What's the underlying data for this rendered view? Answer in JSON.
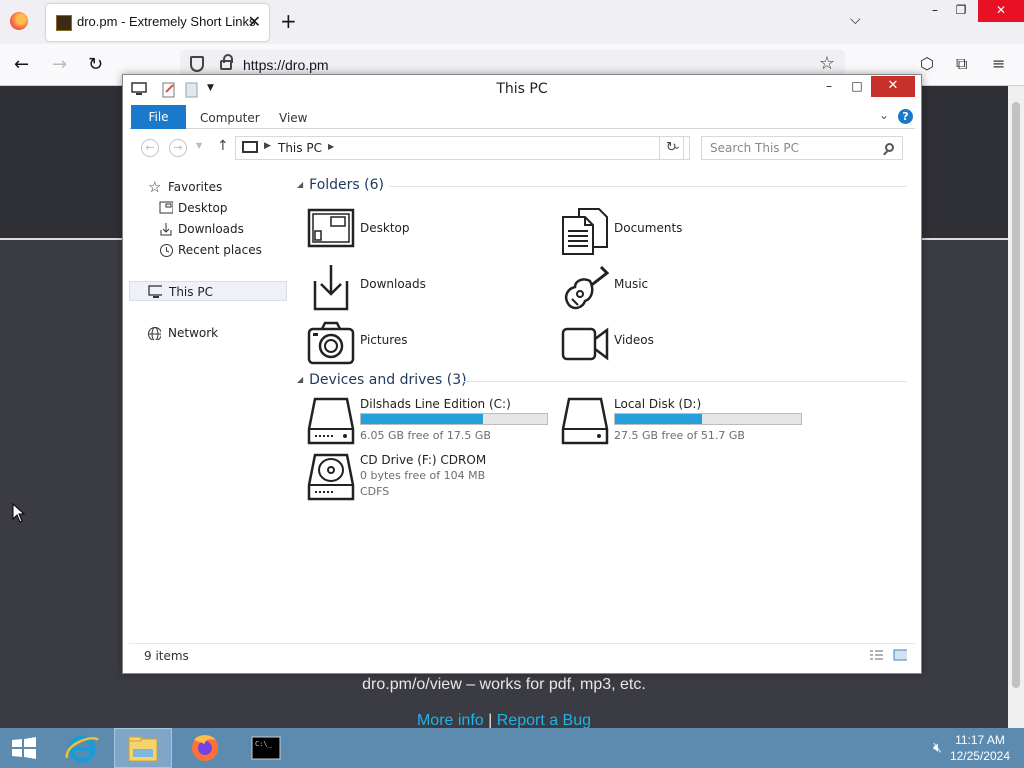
{
  "browser": {
    "tab_title": "dro.pm - Extremely Short Links",
    "url": "https://dro.pm",
    "new_tab_symbol": "+",
    "tab_close_symbol": "✕"
  },
  "page": {
    "line1": "dro.pm/o/view – works for pdf, mp3, etc.",
    "more_info": "More info",
    "separator": "|",
    "report_bug": "Report a Bug"
  },
  "explorer": {
    "title": "This PC",
    "ribbon": {
      "file": "File",
      "computer": "Computer",
      "view": "View",
      "help": "?"
    },
    "address": {
      "location": "This PC"
    },
    "search": {
      "placeholder": "Search This PC"
    },
    "nav": {
      "favorites": "Favorites",
      "desktop": "Desktop",
      "downloads": "Downloads",
      "recent": "Recent places",
      "this_pc": "This PC",
      "network": "Network"
    },
    "folders_header": "Folders (6)",
    "folders": [
      {
        "name": "Desktop",
        "icon": "desktop-icon"
      },
      {
        "name": "Documents",
        "icon": "documents-icon"
      },
      {
        "name": "Downloads",
        "icon": "downloads-icon"
      },
      {
        "name": "Music",
        "icon": "music-icon"
      },
      {
        "name": "Pictures",
        "icon": "pictures-icon"
      },
      {
        "name": "Videos",
        "icon": "videos-icon"
      }
    ],
    "devices_header": "Devices and drives (3)",
    "drives": [
      {
        "name": "Dilshads Line Edition (C:)",
        "free": "6.05 GB free of 17.5 GB",
        "used_fraction": 0.654
      },
      {
        "name": "Local Disk (D:)",
        "free": "27.5 GB free of 51.7 GB",
        "used_fraction": 0.468
      },
      {
        "name": "CD Drive (F:) CDROM",
        "free": "0 bytes free of 104 MB",
        "fs": "CDFS"
      }
    ],
    "status": "9 items"
  },
  "taskbar": {
    "time": "11:17 AM",
    "date": "12/25/2024"
  },
  "colors": {
    "accent": "#1979ca",
    "drive_bar": "#26a0da",
    "close_red": "#c7302b",
    "taskbar": "#5d8bb0",
    "page_bg": "#3b3b43",
    "link": "#1fb3e8"
  }
}
